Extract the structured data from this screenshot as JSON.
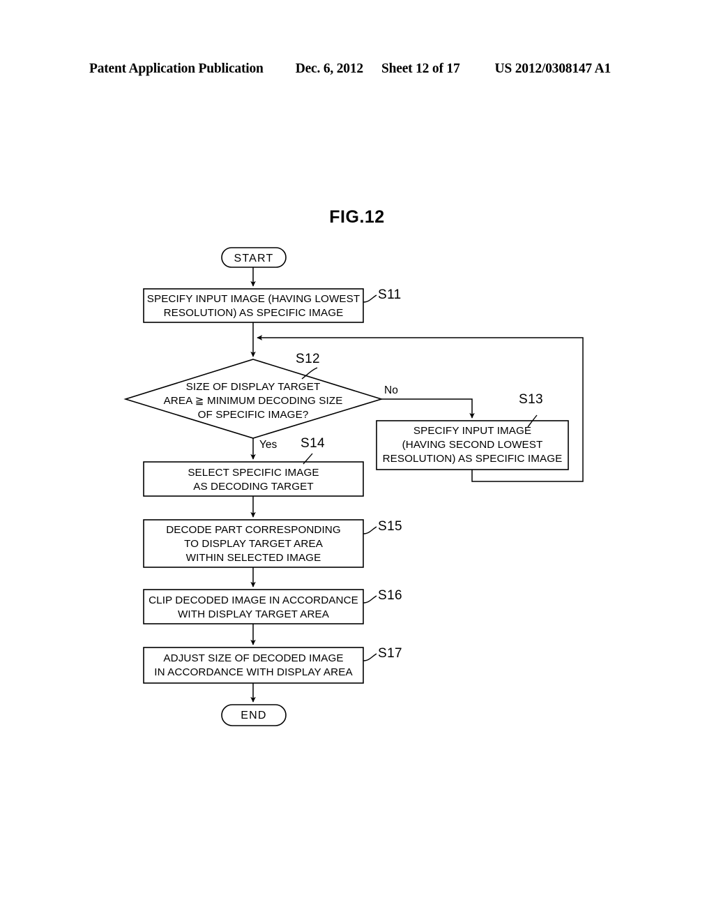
{
  "header": {
    "publication": "Patent Application Publication",
    "date": "Dec. 6, 2012",
    "sheet": "Sheet 12 of 17",
    "number": "US 2012/0308147 A1"
  },
  "figure": {
    "title": "FIG.12",
    "start_label": "START",
    "end_label": "END",
    "branch_yes": "Yes",
    "branch_no": "No",
    "nodes": {
      "s11": {
        "step": "S11",
        "text": "SPECIFY INPUT IMAGE (HAVING LOWEST\nRESOLUTION) AS SPECIFIC IMAGE"
      },
      "s12": {
        "step": "S12",
        "text": "SIZE OF DISPLAY TARGET\nAREA ≧ MINIMUM DECODING SIZE\nOF SPECIFIC IMAGE?"
      },
      "s13": {
        "step": "S13",
        "text": "SPECIFY INPUT IMAGE\n(HAVING SECOND LOWEST\nRESOLUTION) AS SPECIFIC IMAGE"
      },
      "s14": {
        "step": "S14",
        "text": "SELECT SPECIFIC IMAGE\nAS DECODING TARGET"
      },
      "s15": {
        "step": "S15",
        "text": "DECODE PART CORRESPONDING\nTO DISPLAY TARGET AREA\nWITHIN SELECTED IMAGE"
      },
      "s16": {
        "step": "S16",
        "text": "CLIP DECODED IMAGE IN ACCORDANCE\nWITH DISPLAY TARGET AREA"
      },
      "s17": {
        "step": "S17",
        "text": "ADJUST SIZE OF DECODED IMAGE\nIN ACCORDANCE WITH DISPLAY AREA"
      }
    }
  },
  "colors": {
    "ink": "#000000",
    "paper": "#ffffff"
  }
}
